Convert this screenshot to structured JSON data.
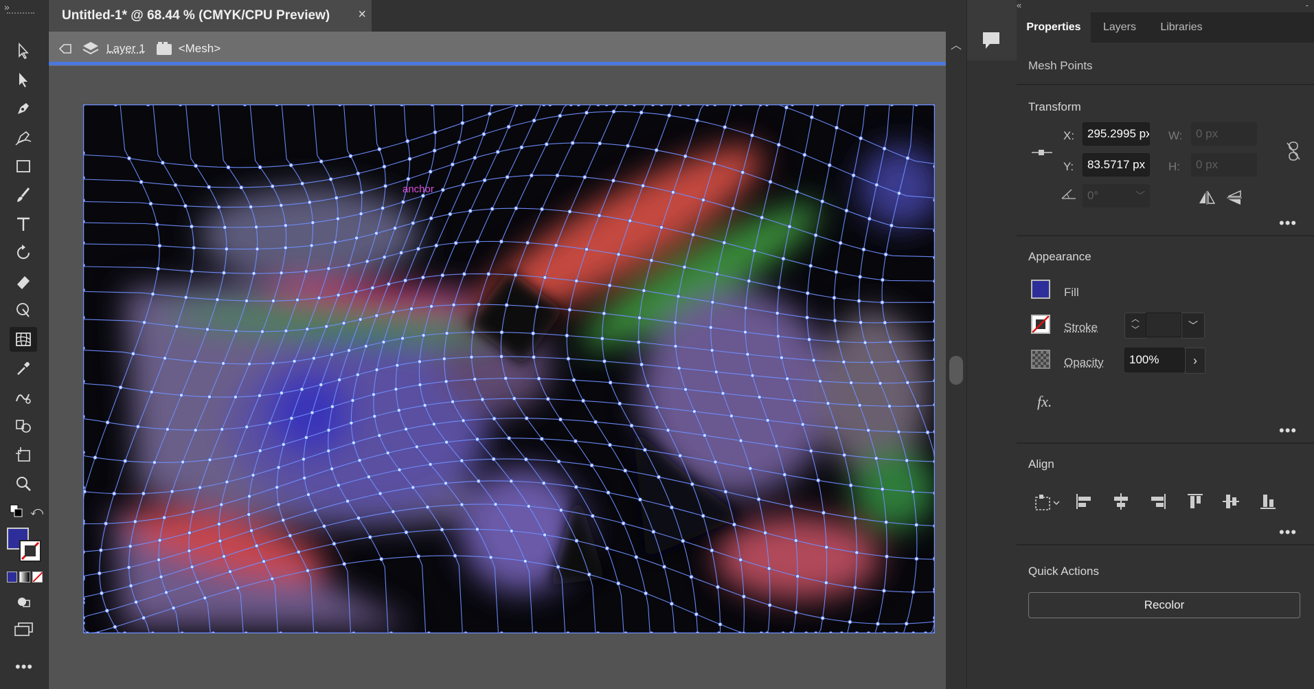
{
  "document": {
    "tab_title": "Untitled-1* @ 68.44 % (CMYK/CPU Preview)",
    "close_label": "×"
  },
  "isolation": {
    "layer": "Layer 1",
    "object": "<Mesh>"
  },
  "canvas": {
    "annotation": "anchor"
  },
  "panel_tabs": [
    "Properties",
    "Layers",
    "Libraries"
  ],
  "properties": {
    "selection_label": "Mesh Points",
    "transform": {
      "title": "Transform",
      "x_label": "X:",
      "x_value": "295.2995 px",
      "y_label": "Y:",
      "y_value": "83.5717 px",
      "w_label": "W:",
      "w_value": "0 px",
      "h_label": "H:",
      "h_value": "0 px",
      "angle_value": "0°"
    },
    "appearance": {
      "title": "Appearance",
      "fill_label": "Fill",
      "fill_color": "#2e2e9a",
      "stroke_label": "Stroke",
      "opacity_label": "Opacity",
      "opacity_value": "100%",
      "fx_label": "fx."
    },
    "align": {
      "title": "Align"
    },
    "quick_actions": {
      "title": "Quick Actions",
      "recolor_label": "Recolor"
    }
  },
  "colors": {
    "accent": "#4a77e0",
    "mesh_line": "#6f8fff",
    "panel_bg": "#323232"
  }
}
